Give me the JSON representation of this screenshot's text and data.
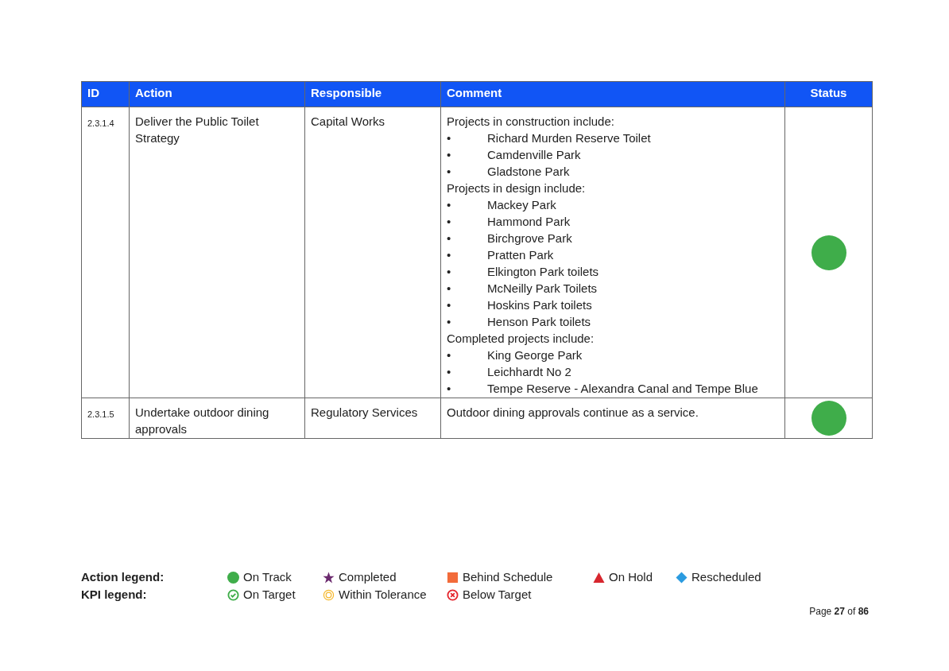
{
  "table": {
    "columns": [
      "ID",
      "Action",
      "Responsible",
      "Comment",
      "Status"
    ],
    "rows": [
      {
        "id": "2.3.1.4",
        "action": "Deliver the Public Toilet Strategy",
        "responsible": "Capital Works",
        "comment": [
          {
            "kind": "heading",
            "text": "Projects in construction include:"
          },
          {
            "kind": "bullet",
            "marker": "•",
            "text": "Richard Murden Reserve Toilet"
          },
          {
            "kind": "bullet",
            "marker": "•",
            "text": "Camdenville Park"
          },
          {
            "kind": "bullet",
            "marker": "•",
            "text": "Gladstone Park"
          },
          {
            "kind": "heading",
            "text": "Projects in design include:"
          },
          {
            "kind": "bullet",
            "marker": "•",
            "text": "Mackey Park"
          },
          {
            "kind": "bullet",
            "marker": "•",
            "text": "Hammond Park"
          },
          {
            "kind": "bullet",
            "marker": "•",
            "text": "Birchgrove Park"
          },
          {
            "kind": "bullet",
            "marker": "•",
            "text": "Pratten Park"
          },
          {
            "kind": "bullet",
            "marker": "•",
            "text": "Elkington Park toilets"
          },
          {
            "kind": "bullet",
            "marker": "•",
            "text": "McNeilly Park Toilets"
          },
          {
            "kind": "bullet",
            "marker": "•",
            "text": "Hoskins Park toilets"
          },
          {
            "kind": "bullet",
            "marker": "•",
            "text": "Henson Park toilets"
          },
          {
            "kind": "heading",
            "text": "Completed projects include:"
          },
          {
            "kind": "bullet",
            "marker": "•",
            "text": "King George Park"
          },
          {
            "kind": "bullet",
            "marker": "•",
            "text": "Leichhardt No 2"
          },
          {
            "kind": "bullet",
            "marker": "•",
            "text": "Tempe Reserve - Alexandra Canal and Tempe Blue"
          }
        ],
        "status": {
          "kind": "circle",
          "color": "#3fad4a"
        }
      },
      {
        "id": "2.3.1.5",
        "action": "Undertake outdoor dining approvals",
        "responsible": "Regulatory Services",
        "comment": [
          {
            "kind": "heading",
            "text": "Outdoor dining approvals continue as a service."
          }
        ],
        "status": {
          "kind": "circle",
          "color": "#3fad4a"
        }
      }
    ]
  },
  "legends": [
    {
      "label": "Action legend:",
      "items": [
        {
          "kind": "circle",
          "color": "#3fad4a",
          "text": "On Track"
        },
        {
          "kind": "star",
          "color": "#6b2a6e",
          "text": "Completed"
        },
        {
          "kind": "square",
          "color": "#f26b3a",
          "text": "Behind Schedule"
        },
        {
          "kind": "triangle",
          "color": "#d7262e",
          "text": "On Hold"
        },
        {
          "kind": "diamond",
          "color": "#2b9be0",
          "text": "Rescheduled"
        }
      ]
    },
    {
      "label": "KPI legend:",
      "items": [
        {
          "kind": "check",
          "color": "#3fad4a",
          "text": "On Target"
        },
        {
          "kind": "rings",
          "color": "#f5b82e",
          "text": "Within Tolerance"
        },
        {
          "kind": "cross",
          "color": "#e5262e",
          "text": "Below Target"
        }
      ]
    }
  ],
  "page_number": "Page **27** of **86**"
}
